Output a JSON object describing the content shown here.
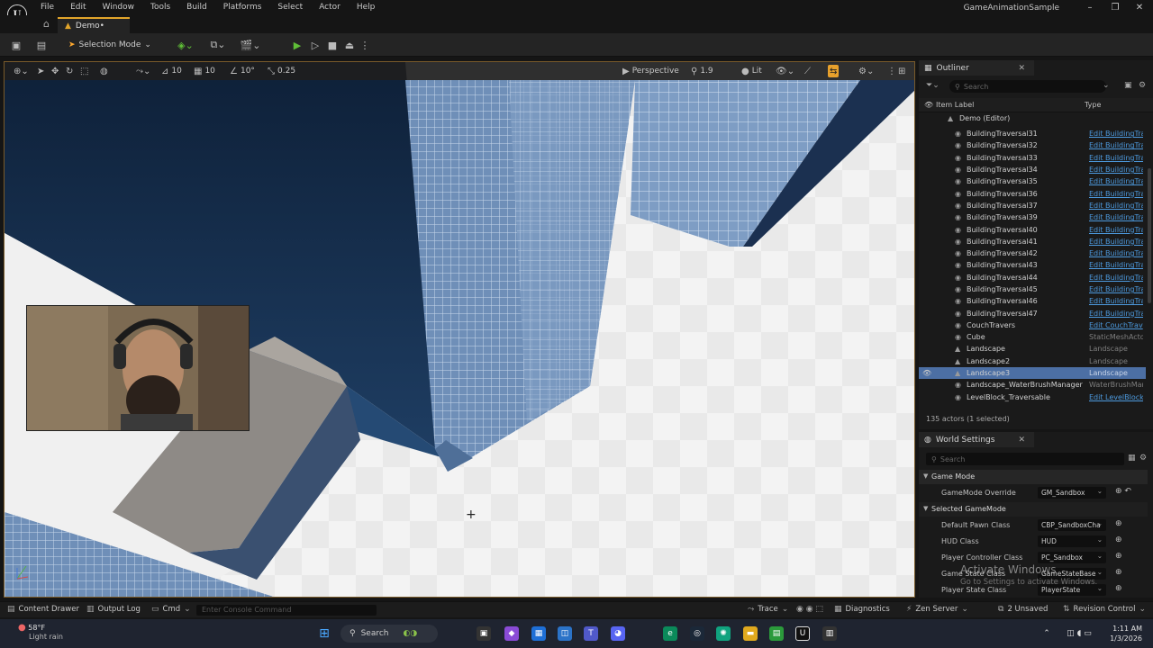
{
  "app": {
    "title": "GameAnimationSample",
    "level_tab": "Demo•"
  },
  "menu": [
    "File",
    "Edit",
    "Window",
    "Tools",
    "Build",
    "Platforms",
    "Select",
    "Actor",
    "Help"
  ],
  "toolbar": {
    "mode": "Selection Mode"
  },
  "viewport": {
    "perspective": "Perspective",
    "view_mode": "Lit",
    "grid_snap": "10",
    "rot_snap": "10°",
    "scale_snap": "0.25",
    "camera_speed": "1.9"
  },
  "outliner": {
    "title": "Outliner",
    "search_placeholder": "Search",
    "col_label": "Item Label",
    "col_type": "Type",
    "root": "Demo (Editor)",
    "rows": [
      {
        "label": "BuildingTraversal31",
        "type": "Edit BuildingTra",
        "link": true
      },
      {
        "label": "BuildingTraversal32",
        "type": "Edit BuildingTra",
        "link": true
      },
      {
        "label": "BuildingTraversal33",
        "type": "Edit BuildingTra",
        "link": true
      },
      {
        "label": "BuildingTraversal34",
        "type": "Edit BuildingTra",
        "link": true
      },
      {
        "label": "BuildingTraversal35",
        "type": "Edit BuildingTra",
        "link": true
      },
      {
        "label": "BuildingTraversal36",
        "type": "Edit BuildingTra",
        "link": true
      },
      {
        "label": "BuildingTraversal37",
        "type": "Edit BuildingTra",
        "link": true
      },
      {
        "label": "BuildingTraversal39",
        "type": "Edit BuildingTra",
        "link": true
      },
      {
        "label": "BuildingTraversal40",
        "type": "Edit BuildingTra",
        "link": true
      },
      {
        "label": "BuildingTraversal41",
        "type": "Edit BuildingTra",
        "link": true
      },
      {
        "label": "BuildingTraversal42",
        "type": "Edit BuildingTra",
        "link": true
      },
      {
        "label": "BuildingTraversal43",
        "type": "Edit BuildingTra",
        "link": true
      },
      {
        "label": "BuildingTraversal44",
        "type": "Edit BuildingTra",
        "link": true
      },
      {
        "label": "BuildingTraversal45",
        "type": "Edit BuildingTra",
        "link": true
      },
      {
        "label": "BuildingTraversal46",
        "type": "Edit BuildingTra",
        "link": true
      },
      {
        "label": "BuildingTraversal47",
        "type": "Edit BuildingTra",
        "link": true
      },
      {
        "label": "CouchTravers",
        "type": "Edit CouchTrav",
        "link": true
      },
      {
        "label": "Cube",
        "type": "StaticMeshActo",
        "link": false
      },
      {
        "label": "Landscape",
        "type": "Landscape",
        "link": false
      },
      {
        "label": "Landscape2",
        "type": "Landscape",
        "link": false
      },
      {
        "label": "Landscape3",
        "type": "Landscape",
        "link": false,
        "selected": true
      },
      {
        "label": "Landscape_WaterBrushManager",
        "type": "WaterBrushMan",
        "link": false
      },
      {
        "label": "LevelBlock_Traversable",
        "type": "Edit LevelBlock",
        "link": true
      }
    ],
    "footer": "135 actors (1 selected)"
  },
  "world_settings": {
    "title": "World Settings",
    "search_placeholder": "Search",
    "section_game_mode": "Game Mode",
    "game_mode_override_label": "GameMode Override",
    "game_mode_override_value": "GM_Sandbox",
    "section_selected": "Selected GameMode",
    "props": [
      {
        "label": "Default Pawn Class",
        "value": "CBP_SandboxCha"
      },
      {
        "label": "HUD Class",
        "value": "HUD"
      },
      {
        "label": "Player Controller Class",
        "value": "PC_Sandbox"
      },
      {
        "label": "Game State Class",
        "value": "GameStateBase"
      },
      {
        "label": "Player State Class",
        "value": "PlayerState"
      }
    ],
    "activate_title": "Activate Windows",
    "activate_sub": "Go to Settings to activate Windows."
  },
  "statusbar": {
    "content_drawer": "Content Drawer",
    "output_log": "Output Log",
    "cmd": "Cmd",
    "console_placeholder": "Enter Console Command",
    "trace": "Trace",
    "diagnostics": "Diagnostics",
    "zen": "Zen Server",
    "unsaved": "2 Unsaved",
    "revision": "Revision Control"
  },
  "taskbar": {
    "weather_temp": "58°F",
    "weather_desc": "Light rain",
    "search": "Search",
    "time": "1:11 AM",
    "date": "1/3/2026"
  }
}
